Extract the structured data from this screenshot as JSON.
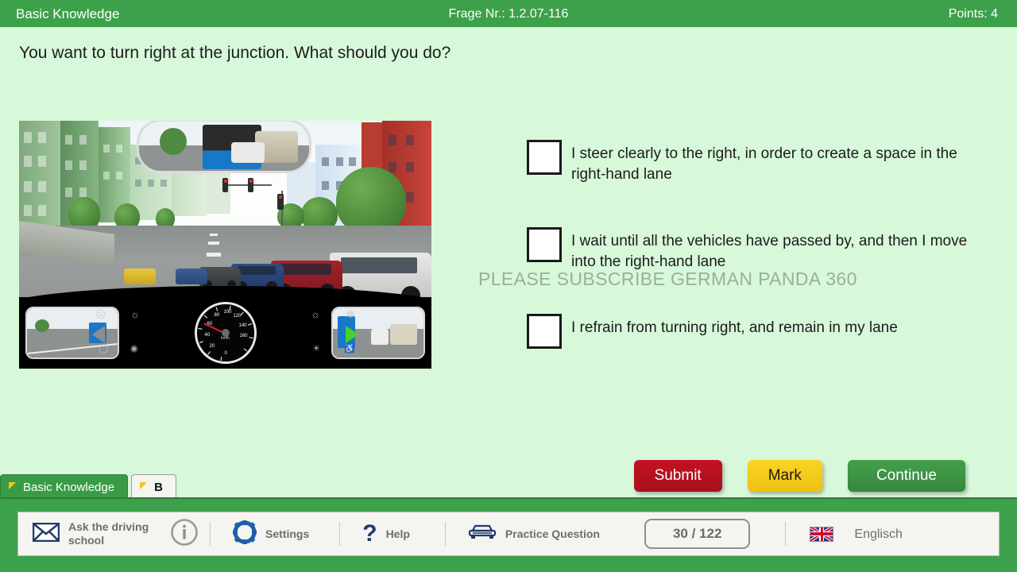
{
  "header": {
    "title": "Basic Knowledge",
    "question_number": "Frage Nr.: 1.2.07-116",
    "points": "Points: 4"
  },
  "question": {
    "text": "You want to turn right at the junction. What should you do?"
  },
  "watermark": {
    "text": "PLEASE SUBSCRIBE GERMAN PANDA 360"
  },
  "scene": {
    "gauge": {
      "unit": "km/h",
      "ticks": [
        "0",
        "20",
        "40",
        "60",
        "80",
        "100",
        "120",
        "140",
        "160"
      ]
    }
  },
  "answers": [
    {
      "id": "answer-1",
      "text": "I steer clearly to the right, in order to create a space in the right-hand lane",
      "checked": false
    },
    {
      "id": "answer-2",
      "text": "I wait until all the vehicles have passed by, and then I move into the right-hand lane",
      "checked": false
    },
    {
      "id": "answer-3",
      "text": "I refrain from turning right, and remain in my lane",
      "checked": false
    }
  ],
  "tabs": [
    {
      "label": "Basic Knowledge",
      "active": true
    },
    {
      "label": "B",
      "active": false
    }
  ],
  "actions": {
    "submit": "Submit",
    "mark": "Mark",
    "continue": "Continue"
  },
  "toolbar": {
    "ask_school": "Ask the driving school",
    "settings": "Settings",
    "help": "Help",
    "practice": "Practice Question",
    "counter": "30 / 122",
    "language": "Englisch"
  },
  "colors": {
    "brand_green": "#3da04a",
    "page_bg": "#d8f8da",
    "submit_red": "#c41122",
    "mark_yellow": "#f9d423",
    "continue_green": "#43a04c",
    "tab_marker_yellow": "#f5c518"
  }
}
